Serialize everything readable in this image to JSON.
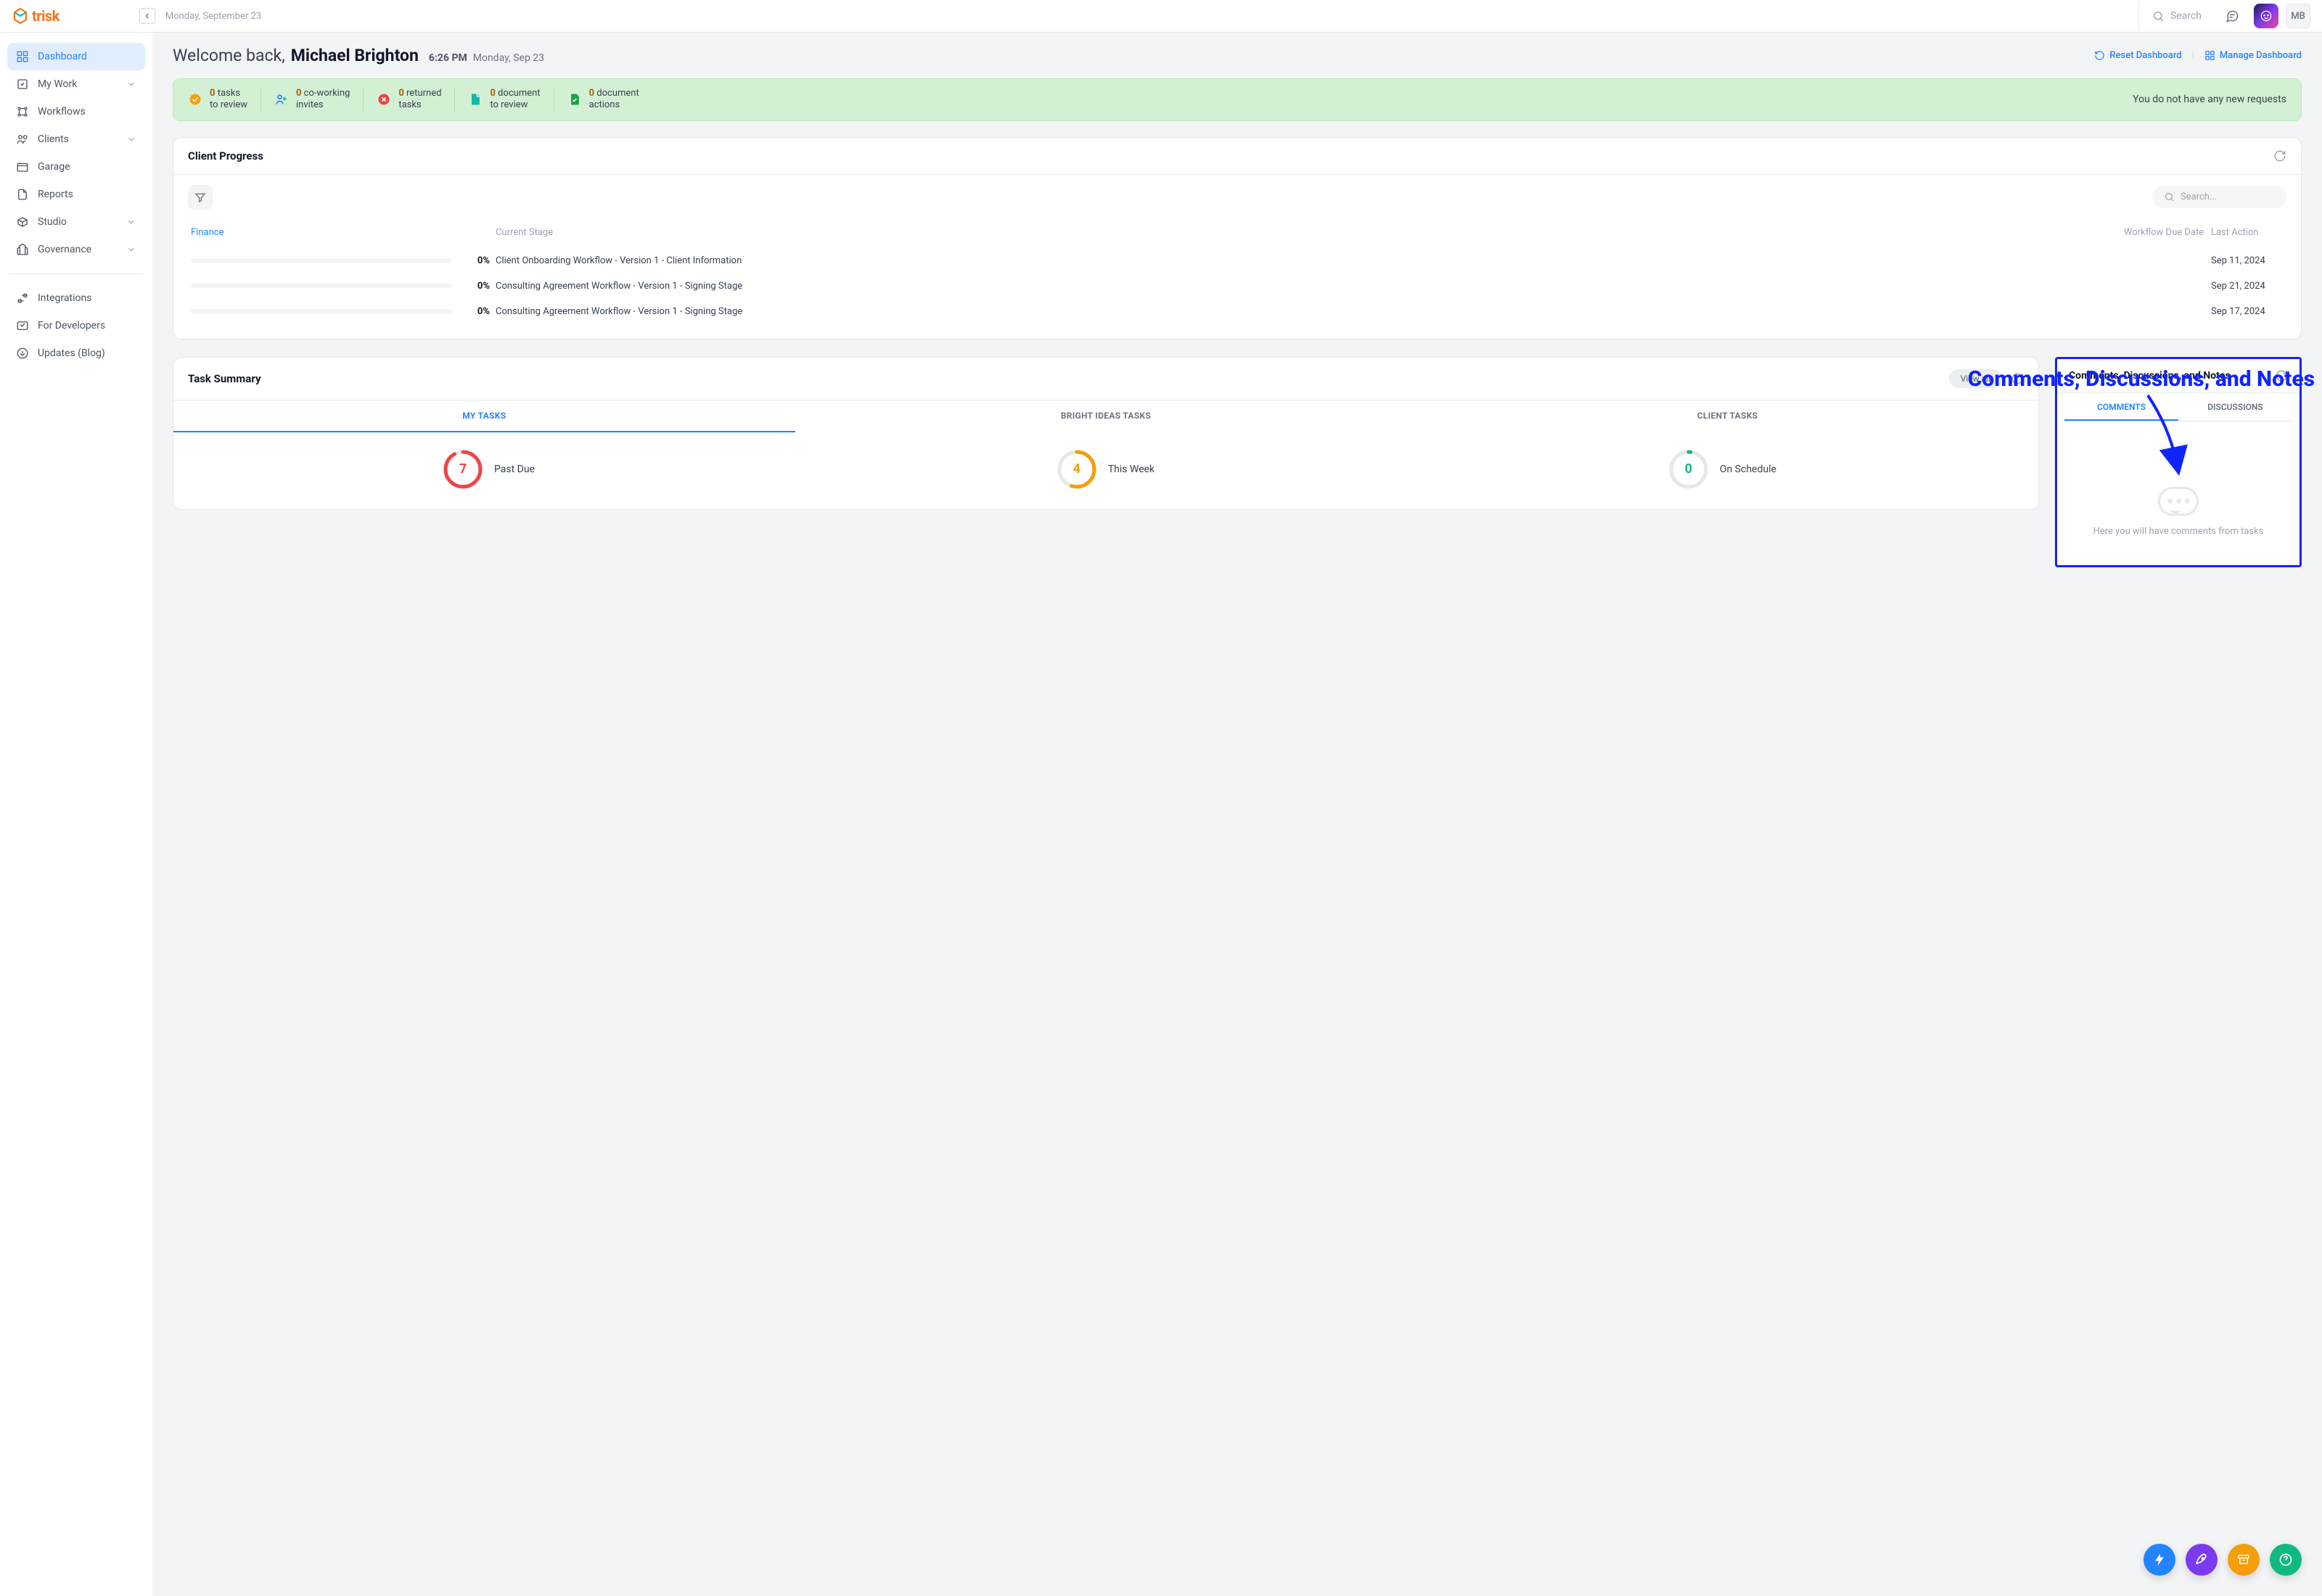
{
  "brand": {
    "name": "trisk"
  },
  "topbar": {
    "date": "Monday, September 23",
    "search_placeholder": "Search",
    "avatar_initials": "MB"
  },
  "sidebar": {
    "items": [
      {
        "label": "Dashboard",
        "active": true,
        "expandable": false
      },
      {
        "label": "My Work",
        "active": false,
        "expandable": true
      },
      {
        "label": "Workflows",
        "active": false,
        "expandable": false
      },
      {
        "label": "Clients",
        "active": false,
        "expandable": true
      },
      {
        "label": "Garage",
        "active": false,
        "expandable": false
      },
      {
        "label": "Reports",
        "active": false,
        "expandable": false
      },
      {
        "label": "Studio",
        "active": false,
        "expandable": true
      },
      {
        "label": "Governance",
        "active": false,
        "expandable": true
      }
    ],
    "items2": [
      {
        "label": "Integrations"
      },
      {
        "label": "For Developers"
      },
      {
        "label": "Updates (Blog)"
      }
    ]
  },
  "welcome": {
    "label": "Welcome back,",
    "name": "Michael Brighton",
    "time": "6:26 PM",
    "date": "Monday, Sep 23",
    "reset": "Reset Dashboard",
    "manage": "Manage Dashboard"
  },
  "alerts": {
    "items": [
      {
        "count": "0",
        "l1": "tasks",
        "l2": "to review"
      },
      {
        "count": "0",
        "l1": "co-working",
        "l2": "invites"
      },
      {
        "count": "0",
        "l1": "returned",
        "l2": "tasks"
      },
      {
        "count": "0",
        "l1": "document",
        "l2": "to review"
      },
      {
        "count": "0",
        "l1": "document",
        "l2": "actions"
      }
    ],
    "note": "You do not have any new requests"
  },
  "client_progress": {
    "title": "Client Progress",
    "search_placeholder": "Search...",
    "headers": {
      "c1": "Finance",
      "c2": "Current Stage",
      "c3": "Workflow Due Date",
      "c4": "Last Action"
    },
    "rows": [
      {
        "pct": "0%",
        "stage": "Client Onboarding Workflow - Version 1 - Client Information",
        "due": "",
        "last": "Sep 11, 2024"
      },
      {
        "pct": "0%",
        "stage": "Consulting Agreement Workflow - Version 1 - Signing Stage",
        "due": "",
        "last": "Sep 21, 2024"
      },
      {
        "pct": "0%",
        "stage": "Consulting Agreement Workflow - Version 1 - Signing Stage",
        "due": "",
        "last": "Sep 17, 2024"
      }
    ]
  },
  "annotation": "Comments, Discussions, and Notes",
  "task_summary": {
    "title": "Task Summary",
    "view_all": "View all",
    "tabs": [
      "MY TASKS",
      "BRIGHT IDEAS TASKS",
      "CLIENT TASKS"
    ],
    "metrics": [
      {
        "value": "7",
        "label": "Past Due",
        "color": "#ef4444",
        "pct": 92
      },
      {
        "value": "4",
        "label": "This Week",
        "color": "#f59e0b",
        "pct": 55
      },
      {
        "value": "0",
        "label": "On Schedule",
        "color": "#10b981",
        "pct": 2
      }
    ]
  },
  "comments": {
    "title": "Comments, Discussions, and Notes",
    "tabs": [
      "COMMENTS",
      "DISCUSSIONS"
    ],
    "empty_text": "Here you will have comments from tasks"
  }
}
